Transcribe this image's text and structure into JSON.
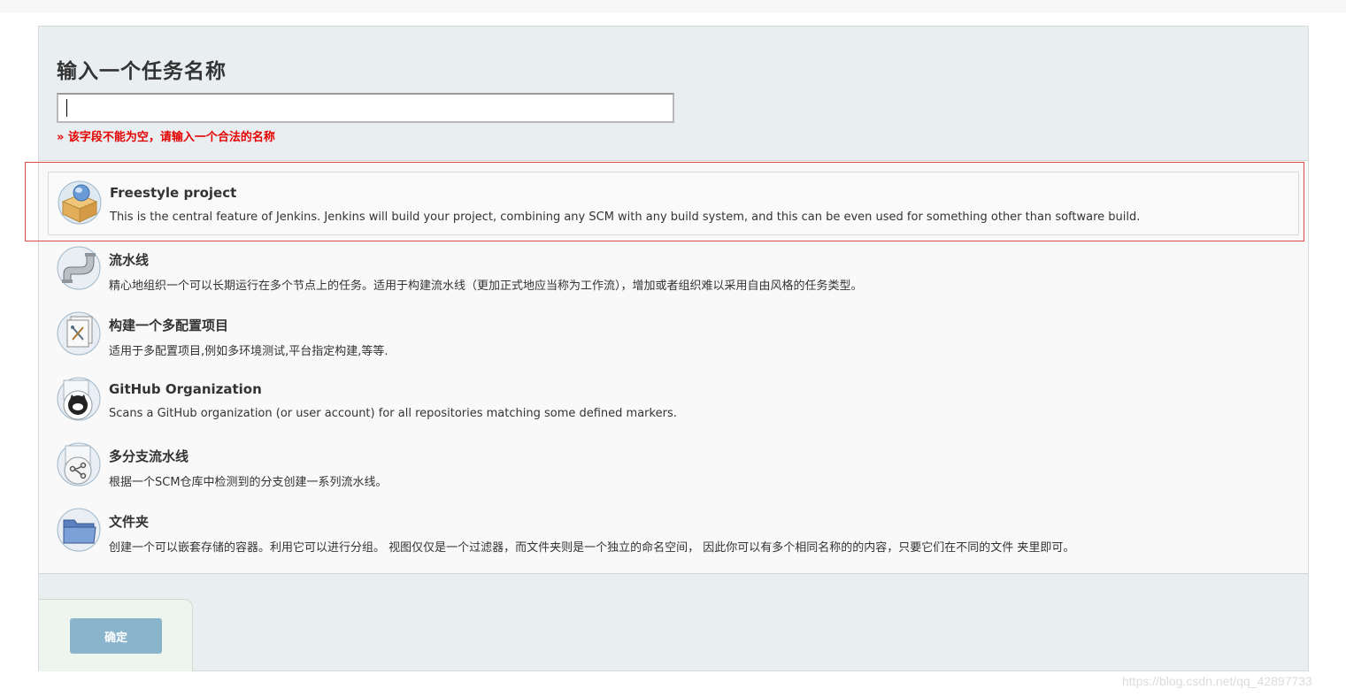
{
  "header": {
    "title": "输入一个任务名称",
    "input_value": "",
    "error": "» 该字段不能为空，请输入一个合法的名称"
  },
  "items": [
    {
      "title": "Freestyle project",
      "desc": "This is the central feature of Jenkins. Jenkins will build your project, combining any SCM with any build system, and this can be even used for something other than software build.",
      "icon": "freestyle-box-icon",
      "selected": true
    },
    {
      "title": "流水线",
      "desc": "精心地组织一个可以长期运行在多个节点上的任务。适用于构建流水线（更加正式地应当称为工作流），增加或者组织难以采用自由风格的任务类型。",
      "icon": "pipeline-icon"
    },
    {
      "title": "构建一个多配置项目",
      "desc": "适用于多配置项目,例如多环境测试,平台指定构建,等等.",
      "icon": "multi-config-icon"
    },
    {
      "title": "GitHub Organization",
      "desc": "Scans a GitHub organization (or user account) for all repositories matching some defined markers.",
      "icon": "github-icon"
    },
    {
      "title": "多分支流水线",
      "desc": "根据一个SCM仓库中检测到的分支创建一系列流水线。",
      "icon": "multibranch-icon"
    },
    {
      "title": "文件夹",
      "desc": "创建一个可以嵌套存储的容器。利用它可以进行分组。 视图仅仅是一个过滤器，而文件夹则是一个独立的命名空间， 因此你可以有多个相同名称的的内容，只要它们在不同的文件 夹里即可。",
      "icon": "folder-icon"
    }
  ],
  "footer": {
    "ok_label": "确定"
  },
  "watermark": "https://blog.csdn.net/qq_42897733",
  "colors": {
    "error": "#e60000",
    "button": "#8ab3cc",
    "header_bg": "#e9eef1"
  }
}
